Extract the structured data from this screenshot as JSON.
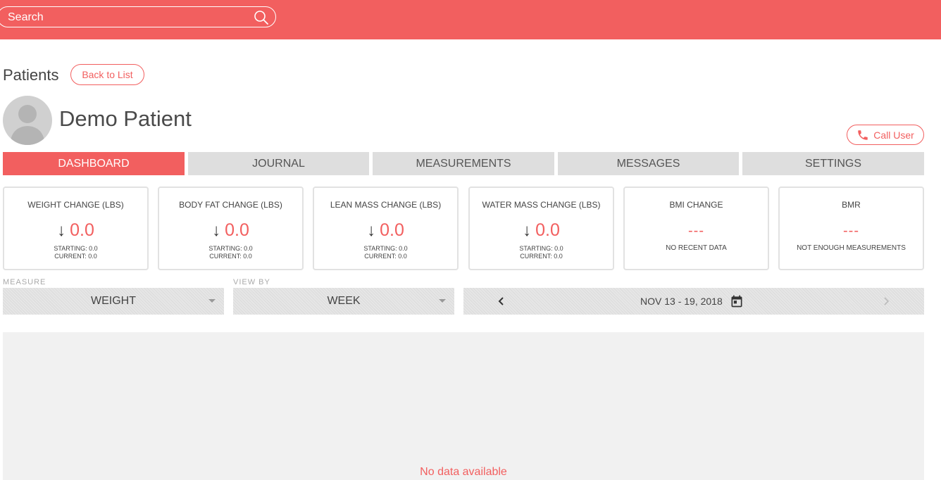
{
  "search": {
    "placeholder": "Search"
  },
  "header": {
    "patients_label": "Patients",
    "back_label": "Back to List"
  },
  "patient": {
    "name": "Demo Patient",
    "call_label": "Call User"
  },
  "tabs": [
    {
      "label": "DASHBOARD",
      "active": true
    },
    {
      "label": "JOURNAL",
      "active": false
    },
    {
      "label": "MEASUREMENTS",
      "active": false
    },
    {
      "label": "MESSAGES",
      "active": false
    },
    {
      "label": "SETTINGS",
      "active": false
    }
  ],
  "cards": [
    {
      "title": "WEIGHT CHANGE (LBS)",
      "value": "0.0",
      "starting": "STARTING: 0.0",
      "current": "CURRENT: 0.0"
    },
    {
      "title": "BODY FAT CHANGE (LBS)",
      "value": "0.0",
      "starting": "STARTING: 0.0",
      "current": "CURRENT: 0.0"
    },
    {
      "title": "LEAN MASS CHANGE (LBS)",
      "value": "0.0",
      "starting": "STARTING: 0.0",
      "current": "CURRENT: 0.0"
    },
    {
      "title": "WATER MASS CHANGE (LBS)",
      "value": "0.0",
      "starting": "STARTING: 0.0",
      "current": "CURRENT: 0.0"
    },
    {
      "title": "BMI CHANGE",
      "value": "---",
      "note": "NO RECENT DATA"
    },
    {
      "title": "BMR",
      "value": "---",
      "note": "NOT ENOUGH MEASUREMENTS"
    }
  ],
  "filters": {
    "measure_label": "MEASURE",
    "measure_value": "WEIGHT",
    "viewby_label": "VIEW BY",
    "viewby_value": "WEEK",
    "date_range": "NOV 13 - 19, 2018"
  },
  "chart": {
    "empty_message": "No data available"
  },
  "colors": {
    "accent": "#f25f5f",
    "tab_inactive": "#dedede",
    "chart_bg": "#f1f1f1"
  }
}
